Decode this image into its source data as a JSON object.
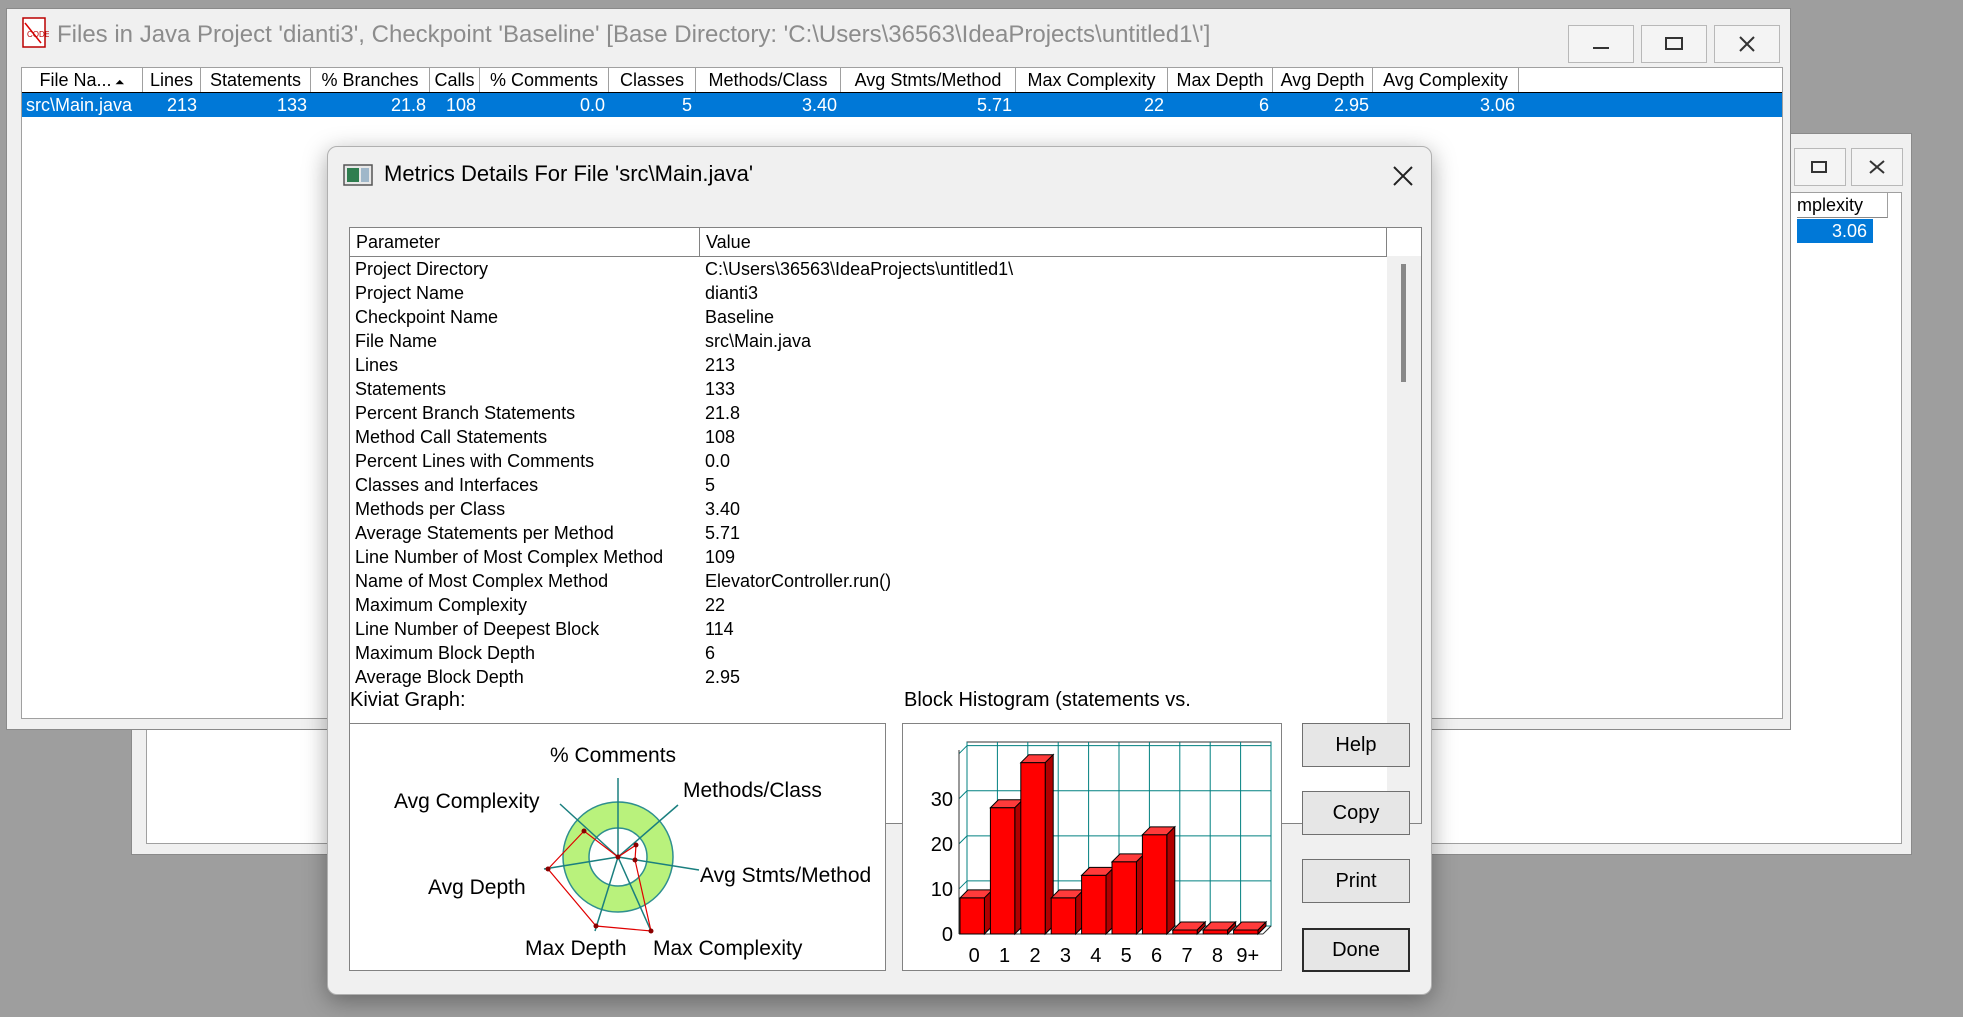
{
  "back_window": {
    "header_partial": "mplexity",
    "value_partial": "3.06"
  },
  "main_window": {
    "title": "Files in Java Project 'dianti3', Checkpoint 'Baseline'  [Base Directory: 'C:\\Users\\36563\\IdeaProjects\\untitled1\\']",
    "columns": [
      "File Na...",
      "Lines",
      "Statements",
      "% Branches",
      "Calls",
      "% Comments",
      "Classes",
      "Methods/Class",
      "Avg Stmts/Method",
      "Max Complexity",
      "Max Depth",
      "Avg Depth",
      "Avg Complexity"
    ],
    "rows": [
      [
        "src\\Main.java",
        "213",
        "133",
        "21.8",
        "108",
        "0.0",
        "5",
        "3.40",
        "5.71",
        "22",
        "6",
        "2.95",
        "3.06"
      ]
    ]
  },
  "dialog": {
    "title": "Metrics Details For File 'src\\Main.java'",
    "param_header": "Parameter",
    "value_header": "Value",
    "params": [
      {
        "p": "Project Directory",
        "v": "C:\\Users\\36563\\IdeaProjects\\untitled1\\"
      },
      {
        "p": "Project Name",
        "v": "dianti3"
      },
      {
        "p": "Checkpoint Name",
        "v": "Baseline"
      },
      {
        "p": "File Name",
        "v": "src\\Main.java"
      },
      {
        "p": "Lines",
        "v": "213"
      },
      {
        "p": "Statements",
        "v": "133"
      },
      {
        "p": "Percent Branch Statements",
        "v": "21.8"
      },
      {
        "p": "Method Call Statements",
        "v": "108"
      },
      {
        "p": "Percent Lines with Comments",
        "v": "0.0"
      },
      {
        "p": "Classes and Interfaces",
        "v": "5"
      },
      {
        "p": "Methods per Class",
        "v": "3.40"
      },
      {
        "p": "Average Statements per Method",
        "v": "5.71"
      },
      {
        "p": "Line Number of Most Complex Method",
        "v": "109"
      },
      {
        "p": "Name of Most Complex Method",
        "v": "ElevatorController.run()"
      },
      {
        "p": "Maximum Complexity",
        "v": "22"
      },
      {
        "p": "Line Number of Deepest Block",
        "v": "114"
      },
      {
        "p": "Maximum Block Depth",
        "v": "6"
      },
      {
        "p": "Average Block Depth",
        "v": "2.95"
      }
    ],
    "kiviat_label": "Kiviat Graph:",
    "kiviat_axes": [
      "% Comments",
      "Methods/Class",
      "Avg Stmts/Method",
      "Max Complexity",
      "Max Depth",
      "Avg Depth",
      "Avg Complexity"
    ],
    "histogram_label": "Block Histogram (statements vs.",
    "buttons": {
      "help": "Help",
      "copy": "Copy",
      "print": "Print",
      "done": "Done"
    }
  },
  "chart_data": {
    "type": "bar",
    "title": "",
    "categories": [
      "0",
      "1",
      "2",
      "3",
      "4",
      "5",
      "6",
      "7",
      "8",
      "9+"
    ],
    "values": [
      8,
      28,
      38,
      8,
      13,
      16,
      22,
      0,
      0,
      0
    ],
    "yticks": [
      "0",
      "10",
      "20",
      "30"
    ],
    "ylim": [
      0,
      40
    ],
    "grid": true,
    "colors": {
      "bar": "#ff0000",
      "grid": "#008080"
    }
  }
}
